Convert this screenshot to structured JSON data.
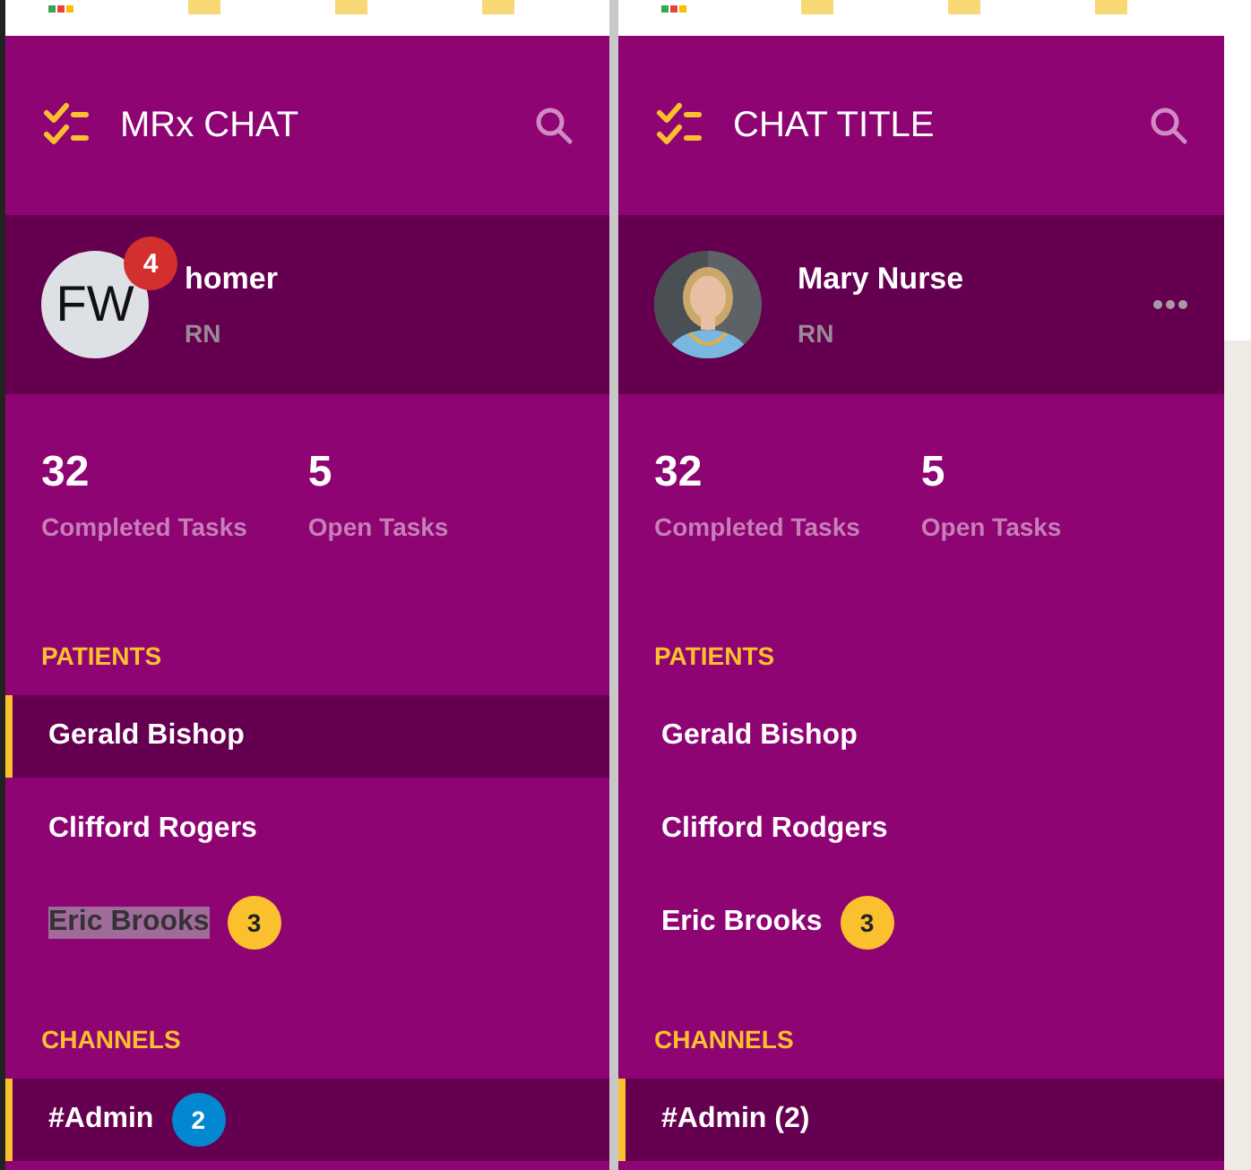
{
  "windows": [
    {
      "bookmarks": [
        {
          "kind": "apps"
        },
        {
          "kind": "folder"
        },
        {
          "kind": "folder"
        },
        {
          "kind": "folder"
        }
      ],
      "header": {
        "title": "MRx CHAT"
      },
      "profile": {
        "avatar": {
          "kind": "initials",
          "initials": "FW"
        },
        "notifications": "4",
        "name": "homer",
        "role": "RN",
        "has_menu": false
      },
      "stats": [
        {
          "value": "32",
          "label": "Completed Tasks"
        },
        {
          "value": "5",
          "label": "Open Tasks"
        }
      ],
      "sections": [
        {
          "heading": "PATIENTS",
          "items": [
            {
              "label": "Gerald Bishop",
              "selected": true,
              "text_highlighted": false
            },
            {
              "label": "Clifford Rogers",
              "selected": false,
              "text_highlighted": false
            },
            {
              "label": "Eric Brooks",
              "selected": false,
              "text_highlighted": true,
              "badge": "3",
              "color": "#fbc02d"
            }
          ]
        },
        {
          "heading": "CHANNELS",
          "items": [
            {
              "label": "#Admin",
              "selected": true,
              "text_highlighted": false,
              "badge": "2",
              "color": "#0288d1"
            }
          ]
        }
      ]
    },
    {
      "bookmarks": [
        {
          "kind": "apps"
        },
        {
          "kind": "folder"
        },
        {
          "kind": "folder"
        },
        {
          "kind": "folder"
        }
      ],
      "header": {
        "title": "CHAT TITLE"
      },
      "profile": {
        "name": "Mary Nurse",
        "role": "RN",
        "has_menu": true
      },
      "stats": [
        {
          "value": "32",
          "label": "Completed Tasks"
        },
        {
          "value": "5",
          "label": "Open Tasks"
        }
      ],
      "sections": [
        {
          "heading": "PATIENTS",
          "items": [
            {
              "label": "Gerald Bishop",
              "selected": false,
              "text_highlighted": false
            },
            {
              "label": "Clifford Rodgers",
              "selected": false,
              "text_highlighted": false
            },
            {
              "label": "Eric Brooks",
              "selected": false,
              "text_highlighted": false,
              "badge": "3",
              "color": "#fbc02d"
            }
          ]
        },
        {
          "heading": "CHANNELS",
          "items": [
            {
              "label": "#Admin (2)",
              "selected": true,
              "text_highlighted": false
            }
          ]
        }
      ]
    }
  ]
}
